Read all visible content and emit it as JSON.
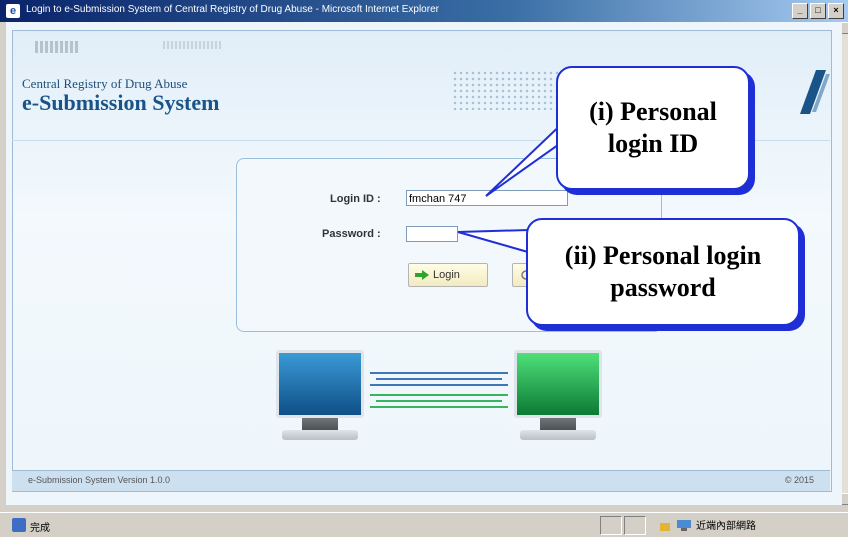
{
  "window": {
    "title": "Login to e-Submission System of Central Registry of Drug Abuse - Microsoft Internet Explorer",
    "buttons": [
      "_",
      "□",
      "×"
    ]
  },
  "header": {
    "org": "Central Registry of Drug Abuse",
    "system_name": "e-Submission System"
  },
  "login_form": {
    "login_id_label": "Login ID :",
    "login_id_value": "fmchan 747",
    "password_label": "Password :",
    "password_value": "",
    "login_button": "Login"
  },
  "footer": {
    "version": "e-Submission System Version 1.0.0",
    "copyright": "© 2015"
  },
  "statusbar": {
    "status_text": "完成",
    "zone_text": "近端內部網路"
  },
  "callouts": {
    "login_id": "(i) Personal login ID",
    "password": "(ii) Personal login password"
  },
  "icons": {
    "login_button_icon": "green-arrow-icon",
    "title_icon": "ie-icon",
    "zone_icon": "intranet-icon"
  },
  "colors": {
    "callout_border": "#1f2fd6",
    "accent_blue": "#1a5388",
    "left_screen": "#1b6fb0",
    "right_screen": "#15a64a"
  }
}
